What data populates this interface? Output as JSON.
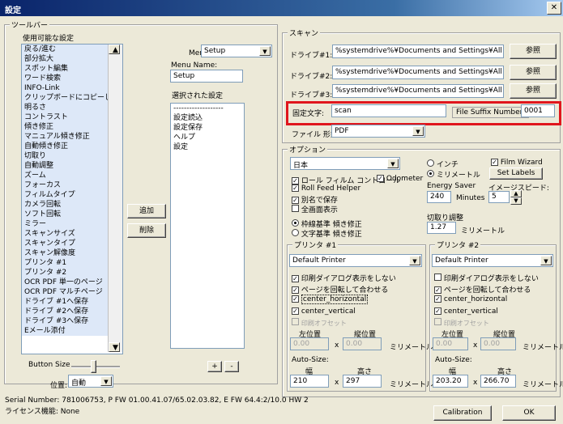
{
  "window": {
    "title": "設定",
    "close_glyph": "✕"
  },
  "toolbar": {
    "legend": "ツールバー",
    "available_label": "使用可能な設定",
    "available_items": [
      "戻る/進む",
      "部分拡大",
      "スポット編集",
      "ワード検索",
      "INFO-Link",
      "クリップボードにコピーします。",
      "明るさ",
      "コントラスト",
      "傾き修正",
      "マニュアル傾き修正",
      "自動傾き修正",
      "切取り",
      "自動調整",
      "ズーム",
      "フォーカス",
      "フィルムタイプ",
      "カメラ回転",
      "ソフト回転",
      "ミラー",
      "スキャンサイズ",
      "スキャンタイプ",
      "スキャン解像度",
      "プリンタ #1",
      "プリンタ #2",
      "OCR PDF 単一のページ",
      "OCR PDF マルチページ",
      "ドライブ #1へ保存",
      "ドライブ #2へ保存",
      "ドライブ #3へ保存",
      "Eメール添付"
    ],
    "menu_label": "Menu:",
    "menu_value": "Setup",
    "menu_name_label": "Menu Name:",
    "menu_name_value": "Setup",
    "selected_label": "選択された設定",
    "selected_items": [
      "-------------------",
      "設定読込",
      "設定保存",
      "ヘルプ",
      "設定"
    ],
    "add_button": "追加",
    "delete_button": "削除",
    "plus_button": "+",
    "minus_button": "-",
    "button_size_label": "Button Size",
    "position_label": "位置:",
    "position_value": "自動"
  },
  "scan": {
    "legend": "スキャン",
    "drives": [
      {
        "label": "ドライブ#1:",
        "path": "%systemdrive%¥Documents and Settings¥All Users¥",
        "browse": "参照"
      },
      {
        "label": "ドライブ#2:",
        "path": "%systemdrive%¥Documents and Settings¥All Users¥",
        "browse": "参照"
      },
      {
        "label": "ドライブ#3:",
        "path": "%systemdrive%¥Documents and Settings¥All Users¥",
        "browse": "参照"
      }
    ],
    "fixed_text_label": "固定文字:",
    "fixed_text_value": "scan",
    "file_suffix_label": "File Suffix Number:",
    "file_suffix_value": "0001",
    "file_format_label": "ファイル 形式:",
    "file_format_value": "PDF"
  },
  "options": {
    "legend": "オプション",
    "language": "日本",
    "inch_label": "インチ",
    "mm_label": "ミリメートル",
    "roll_film_control": "ロール フィルム コントロール",
    "odometer": "Odometer",
    "roll_feed_helper": "Roll Feed Helper",
    "alias_save": "別名で保存",
    "fullscreen": "全画面表示",
    "frame_based": "枠線基準 傾き修正",
    "text_based": "文字基準 傾き修正",
    "film_wizard": "Film Wizard",
    "set_labels": "Set Labels",
    "energy_saver_label": "Energy Saver",
    "energy_saver_value": "240",
    "minutes_label": "Minutes",
    "image_speed_label": "イメージスピード:",
    "image_speed_value": "5",
    "crop_adjust_label": "切取り調整",
    "crop_adjust_value": "1.27",
    "crop_unit": "ミリメートル"
  },
  "printer1": {
    "legend": "プリンタ #1",
    "printer": "Default Printer",
    "show_dialog": "印刷ダイアログ表示をしない",
    "rotate_fit": "ページを回転して合わせる",
    "center_h": "center_horizontal",
    "center_v": "center_vertical",
    "print_offset": "印刷オフセット",
    "left_label": "左位置",
    "top_label": "縦位置",
    "left_value": "0.00",
    "top_value": "0.00",
    "x": "x",
    "unit": "ミリメートル",
    "auto_size": "Auto-Size:",
    "width_label": "幅",
    "height_label": "高さ",
    "width_value": "210",
    "height_value": "297"
  },
  "printer2": {
    "legend": "プリンタ #2",
    "printer": "Default Printer",
    "show_dialog": "印刷ダイアログ表示をしない",
    "rotate_fit": "ページを回転して合わせる",
    "center_h": "center_horizontal",
    "center_v": "center_vertical",
    "print_offset": "印刷オフセット",
    "left_label": "左位置",
    "top_label": "縦位置",
    "left_value": "0.00",
    "top_value": "0.00",
    "x": "x",
    "unit": "ミリメートル",
    "auto_size": "Auto-Size:",
    "width_label": "幅",
    "height_label": "高さ",
    "width_value": "203.20",
    "height_value": "266.70"
  },
  "footer": {
    "serial": "Serial Number: 781006753, P FW 01.00.41.07/65.02.03.82, E FW 64.4:2/10.0 HW 2",
    "license": "ライセンス機能: None",
    "calibration": "Calibration",
    "ok": "OK"
  },
  "icons": {
    "check": "✓",
    "down_arrow": "▼",
    "up_arrow": "▲"
  },
  "colors": {
    "highlight_box": "#e0161d",
    "title_bar": "#0a246a"
  }
}
